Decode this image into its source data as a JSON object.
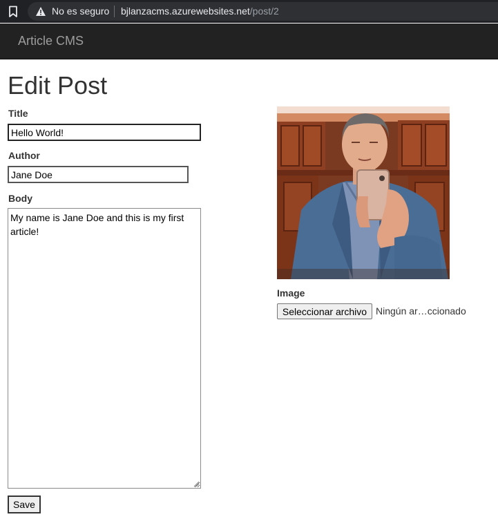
{
  "browser": {
    "security_label": "No es seguro",
    "url_host": "bjlanzacms.azurewebsites.net",
    "url_path": "/post/2"
  },
  "navbar": {
    "brand": "Article CMS"
  },
  "form": {
    "heading": "Edit Post",
    "title_label": "Title",
    "title_value": "Hello World!",
    "author_label": "Author",
    "author_value": "Jane Doe",
    "body_label": "Body",
    "body_value": "My name is Jane Doe and this is my first article!",
    "save_label": "Save"
  },
  "image_section": {
    "label": "Image",
    "file_button_label": "Seleccionar archivo",
    "file_status": "Ningún ar…ccionado"
  },
  "colors": {
    "navbar_bg": "#222222",
    "brand_text": "#9d9d9d",
    "browser_bg": "#202124"
  },
  "icons": [
    "bookmark-icon",
    "warning-icon",
    "resize-grip-icon"
  ]
}
